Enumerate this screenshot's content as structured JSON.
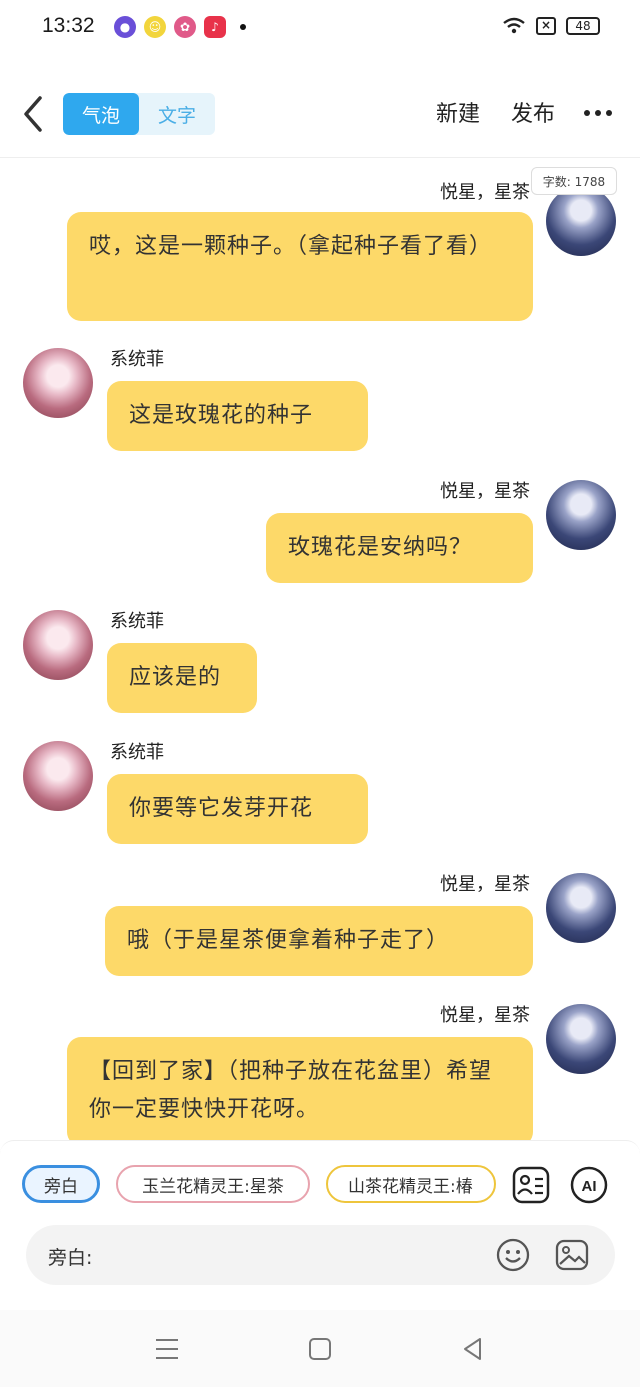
{
  "status": {
    "time": "13:32",
    "battery": "48"
  },
  "header": {
    "tabs": [
      {
        "label": "气泡",
        "active": true
      },
      {
        "label": "文字",
        "active": false
      }
    ],
    "new_label": "新建",
    "publish_label": "发布"
  },
  "word_count": "字数: 1788",
  "messages": [
    {
      "side": "right",
      "name": "悦星，星茶",
      "text": "哎，这是一颗种子。（拿起种子看了看）"
    },
    {
      "side": "left",
      "name": "系统菲",
      "text": "这是玫瑰花的种子"
    },
    {
      "side": "right",
      "name": "悦星，星茶",
      "text": "玫瑰花是安纳吗？"
    },
    {
      "side": "left",
      "name": "系统菲",
      "text": "应该是的"
    },
    {
      "side": "left",
      "name": "系统菲",
      "text": "你要等它发芽开花"
    },
    {
      "side": "right",
      "name": "悦星，星茶",
      "text": "哦（于是星茶便拿着种子走了）"
    },
    {
      "side": "right",
      "name": "悦星，星茶",
      "text": "【回到了家】（把种子放在花盆里）希望你一定要快快开花呀。"
    }
  ],
  "roles": {
    "narration": "旁白",
    "role1": "玉兰花精灵王:星茶",
    "role2": "山茶花精灵王:椿"
  },
  "input": {
    "label": "旁白:",
    "value": ""
  },
  "colors": {
    "bubble": "#fdd969",
    "accent": "#2fa8ee"
  }
}
